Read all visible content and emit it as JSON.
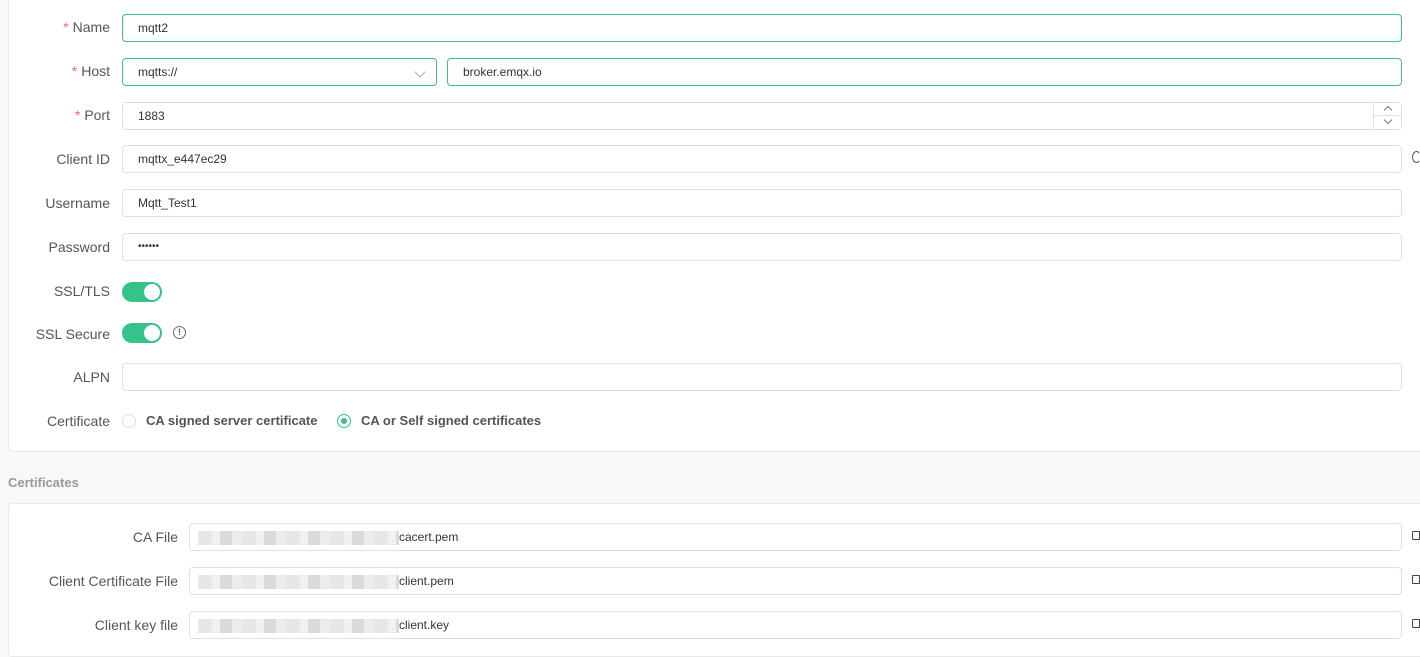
{
  "general": {
    "name": {
      "label": "Name",
      "value": "mqtt2"
    },
    "host": {
      "label": "Host",
      "protocol": "mqtts://",
      "value": "broker.emqx.io"
    },
    "port": {
      "label": "Port",
      "value": "1883"
    },
    "client_id": {
      "label": "Client ID",
      "value": "mqttx_e447ec29"
    },
    "username": {
      "label": "Username",
      "value": "Mqtt_Test1"
    },
    "password": {
      "label": "Password",
      "value": "••••••"
    },
    "ssl_tls": {
      "label": "SSL/TLS",
      "enabled": true
    },
    "ssl_secure": {
      "label": "SSL Secure",
      "enabled": true
    },
    "alpn": {
      "label": "ALPN",
      "value": ""
    },
    "certificate": {
      "label": "Certificate",
      "options": [
        "CA signed server certificate",
        "CA or Self signed certificates"
      ],
      "selected": "CA or Self signed certificates"
    },
    "required_mark": "*"
  },
  "certificates": {
    "title": "Certificates",
    "ca_file": {
      "label": "CA File",
      "value": "cacert.pem"
    },
    "client_cert": {
      "label": "Client Certificate File",
      "value": "client.pem"
    },
    "client_key": {
      "label": "Client key file",
      "value": "client.key"
    }
  },
  "colors": {
    "accent": "#34c388",
    "required": "#f56c6c"
  },
  "icons": {
    "info": "info-icon",
    "refresh": "refresh-icon",
    "folder": "folder-icon"
  }
}
